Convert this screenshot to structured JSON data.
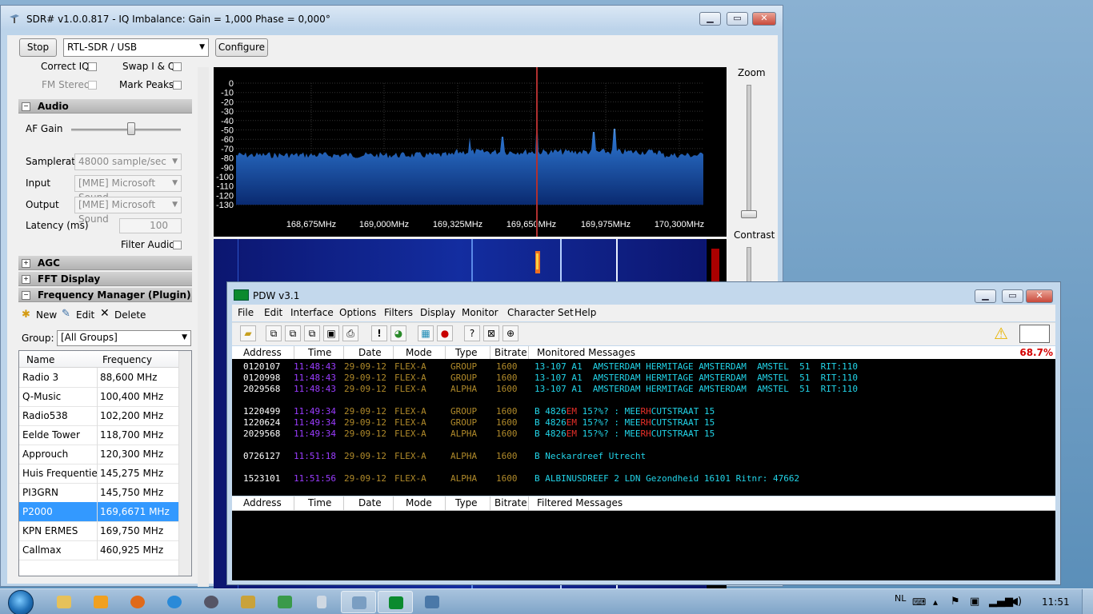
{
  "sdr": {
    "title": "SDR# v1.0.0.817 - IQ Imbalance: Gain = 1,000 Phase = 0,000°",
    "stop_button": "Stop",
    "source": "RTL-SDR / USB",
    "configure_button": "Configure",
    "correct_iq": "Correct IQ",
    "swap_iq": "Swap I & Q",
    "fm_stereo": "FM Stereo",
    "mark_peaks": "Mark Peaks",
    "audio_section": "Audio",
    "af_gain": "AF Gain",
    "af_gain_level": 0.55,
    "samplerate_label": "Samplerate",
    "samplerate_value": "48000 sample/sec",
    "input_label": "Input",
    "input_value": "[MME] Microsoft Sound",
    "output_label": "Output",
    "output_value": "[MME] Microsoft Sound",
    "latency_label": "Latency (ms)",
    "latency_value": "100",
    "filter_audio": "Filter Audio",
    "agc_section": "AGC",
    "fft_section": "FFT Display",
    "freqman_section": "Frequency Manager (Plugin)",
    "new_button": "New",
    "edit_button": "Edit",
    "delete_button": "Delete",
    "group_label": "Group:",
    "group_value": "[All Groups]",
    "col_name": "Name",
    "col_freq": "Frequency",
    "frequencies": [
      {
        "name": "Radio 3",
        "freq": "88,600 MHz"
      },
      {
        "name": "Q-Music",
        "freq": "100,400 MHz"
      },
      {
        "name": "Radio538",
        "freq": "102,200 MHz"
      },
      {
        "name": "Eelde Tower",
        "freq": "118,700 MHz"
      },
      {
        "name": "Approuch",
        "freq": "120,300 MHz"
      },
      {
        "name": "Huis Frequentie",
        "freq": "145,275 MHz"
      },
      {
        "name": "PI3GRN",
        "freq": "145,750 MHz"
      },
      {
        "name": "P2000",
        "freq": "169,6671 MHz"
      },
      {
        "name": "KPN ERMES",
        "freq": "169,750 MHz"
      },
      {
        "name": "Callmax",
        "freq": "460,925 MHz"
      }
    ],
    "selected_index": 7,
    "spectrum_y_labels": [
      "0",
      "-10",
      "-20",
      "-30",
      "-40",
      "-50",
      "-60",
      "-70",
      "-80",
      "-90",
      "-100",
      "-110",
      "-120",
      "-130"
    ],
    "spectrum_x_labels": [
      "168,675MHz",
      "169,000MHz",
      "169,325MHz",
      "169,650MHz",
      "169,975MHz",
      "170,300MHz"
    ],
    "zoom_label": "Zoom",
    "contrast_label": "Contrast"
  },
  "pdw": {
    "title": "PDW v3.1",
    "menu": [
      "File",
      "Edit",
      "Interface",
      "Options",
      "Filters",
      "Display",
      "Monitor",
      "Character Set",
      "Help"
    ],
    "columns": [
      "Address",
      "Time",
      "Date",
      "Mode",
      "Type",
      "Bitrate"
    ],
    "monitored_label": "Monitored Messages",
    "filtered_label": "Filtered Messages",
    "percent": "68.7%",
    "messages": [
      {
        "addr": "0120107",
        "time": "11:48:43",
        "date": "29-09-12",
        "mode": "FLEX-A",
        "type": "GROUP",
        "bitrate": "1600",
        "msg": "13-107 A1  AMSTERDAM HERMITAGE AMSTERDAM  AMSTEL  51  RIT:110"
      },
      {
        "addr": "0120998",
        "time": "11:48:43",
        "date": "29-09-12",
        "mode": "FLEX-A",
        "type": "GROUP",
        "bitrate": "1600",
        "msg": "13-107 A1  AMSTERDAM HERMITAGE AMSTERDAM  AMSTEL  51  RIT:110"
      },
      {
        "addr": "2029568",
        "time": "11:48:43",
        "date": "29-09-12",
        "mode": "FLEX-A",
        "type": "ALPHA",
        "bitrate": "1600",
        "msg": "13-107 A1  AMSTERDAM HERMITAGE AMSTERDAM  AMSTEL  51  RIT:110"
      },
      {
        "addr": "1220499",
        "time": "11:49:34",
        "date": "29-09-12",
        "mode": "FLEX-A",
        "type": "GROUP",
        "bitrate": "1600",
        "msg_a": "B 4826",
        "msg_r": "EM",
        "msg_b": " 15?%? : MEE",
        "msg_r2": "RH",
        "msg_c": "CUTSTRAAT 15"
      },
      {
        "addr": "1220624",
        "time": "11:49:34",
        "date": "29-09-12",
        "mode": "FLEX-A",
        "type": "GROUP",
        "bitrate": "1600",
        "msg_a": "B 4826",
        "msg_r": "EM",
        "msg_b": " 15?%? : MEE",
        "msg_r2": "RH",
        "msg_c": "CUTSTRAAT 15"
      },
      {
        "addr": "2029568",
        "time": "11:49:34",
        "date": "29-09-12",
        "mode": "FLEX-A",
        "type": "ALPHA",
        "bitrate": "1600",
        "msg_a": "B 4826",
        "msg_r": "EM",
        "msg_b": " 15?%? : MEE",
        "msg_r2": "RH",
        "msg_c": "CUTSTRAAT 15"
      },
      {
        "addr": "0726127",
        "time": "11:51:18",
        "date": "29-09-12",
        "mode": "FLEX-A",
        "type": "ALPHA",
        "bitrate": "1600",
        "msg": "B Neckardreef Utrecht"
      },
      {
        "addr": "1523101",
        "time": "11:51:56",
        "date": "29-09-12",
        "mode": "FLEX-A",
        "type": "ALPHA",
        "bitrate": "1600",
        "msg": "B ALBINUSDREEF 2 LDN Gezondheid 16101 Ritnr: 47662"
      }
    ]
  },
  "taskbar": {
    "lang": "NL",
    "clock": "11:51"
  }
}
